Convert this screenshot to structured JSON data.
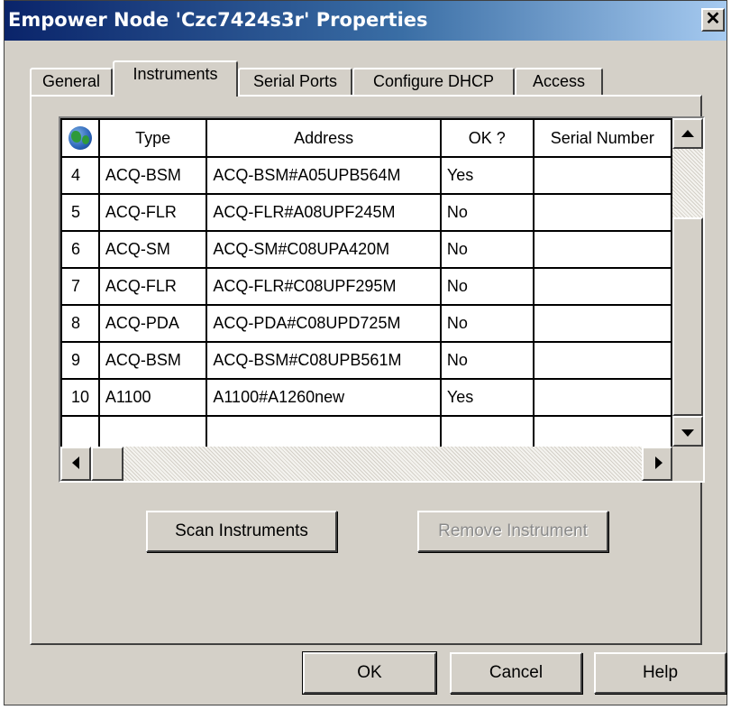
{
  "window": {
    "title": "Empower Node 'Czc7424s3r' Properties",
    "close_glyph": "✕"
  },
  "tabs": [
    {
      "label": "General",
      "active": false
    },
    {
      "label": "Instruments",
      "active": true
    },
    {
      "label": "Serial Ports",
      "active": false
    },
    {
      "label": "Configure DHCP",
      "active": false
    },
    {
      "label": "Access",
      "active": false
    }
  ],
  "grid": {
    "header_icon": "globe-icon",
    "columns": [
      "Type",
      "Address",
      "OK ?",
      "Serial Number"
    ],
    "rows": [
      {
        "num": "4",
        "type": "ACQ-BSM",
        "address": "ACQ-BSM#A05UPB564M",
        "ok": "Yes",
        "serial": ""
      },
      {
        "num": "5",
        "type": "ACQ-FLR",
        "address": "ACQ-FLR#A08UPF245M",
        "ok": "No",
        "serial": ""
      },
      {
        "num": "6",
        "type": "ACQ-SM",
        "address": "ACQ-SM#C08UPA420M",
        "ok": "No",
        "serial": ""
      },
      {
        "num": "7",
        "type": "ACQ-FLR",
        "address": "ACQ-FLR#C08UPF295M",
        "ok": "No",
        "serial": ""
      },
      {
        "num": "8",
        "type": "ACQ-PDA",
        "address": "ACQ-PDA#C08UPD725M",
        "ok": "No",
        "serial": ""
      },
      {
        "num": "9",
        "type": "ACQ-BSM",
        "address": "ACQ-BSM#C08UPB561M",
        "ok": "No",
        "serial": ""
      },
      {
        "num": "10",
        "type": "A1100",
        "address": "A1100#A1260new",
        "ok": "Yes",
        "serial": ""
      },
      {
        "num": "",
        "type": "",
        "address": "",
        "ok": "",
        "serial": ""
      }
    ]
  },
  "buttons": {
    "scan": "Scan Instruments",
    "remove": "Remove Instrument",
    "ok": "OK",
    "cancel": "Cancel",
    "help": "Help"
  },
  "colors": {
    "title_gradient_start": "#0a246a",
    "title_gradient_end": "#a6caf0",
    "face": "#d4d0c8",
    "disabled_text": "#8a8a8a"
  }
}
